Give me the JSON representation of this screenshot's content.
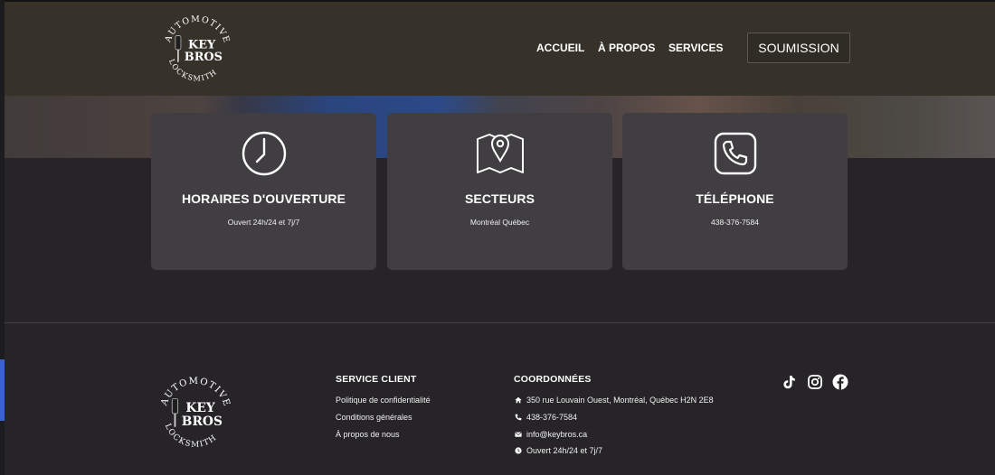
{
  "header": {
    "logo_text": {
      "top": "AUTOMOTIVE",
      "bottom": "LOCKSMITH",
      "line1": "KEY",
      "line2": "BROS"
    },
    "nav": [
      {
        "label": "ACCUEIL"
      },
      {
        "label": "À PROPOS"
      },
      {
        "label": "SERVICES"
      }
    ],
    "cta_label": "SOUMISSION"
  },
  "cards": [
    {
      "icon": "clock-icon",
      "title": "HORAIRES D'OUVERTURE",
      "text": "Ouvert 24h/24 et 7j/7"
    },
    {
      "icon": "map-pin-icon",
      "title": "SECTEURS",
      "text": "Montréal Québec"
    },
    {
      "icon": "phone-icon",
      "title": "TÉLÉPHONE",
      "text": "438-376-7584"
    }
  ],
  "footer": {
    "service": {
      "title": "SERVICE CLIENT",
      "links": [
        "Politique de confidentialité",
        "Conditions générales",
        "À propos de nous"
      ]
    },
    "contact": {
      "title": "COORDONNÉES",
      "items": [
        {
          "icon": "home-icon",
          "text": "350 rue Louvain Ouest, Montréal, Québec H2N 2E8"
        },
        {
          "icon": "phone-icon",
          "text": "438-376-7584"
        },
        {
          "icon": "envelope-icon",
          "text": "info@keybros.ca"
        },
        {
          "icon": "clock-icon",
          "text": "Ouvert 24h/24 et 7j/7"
        }
      ]
    },
    "social": [
      "tiktok-icon",
      "instagram-icon",
      "facebook-icon"
    ]
  }
}
